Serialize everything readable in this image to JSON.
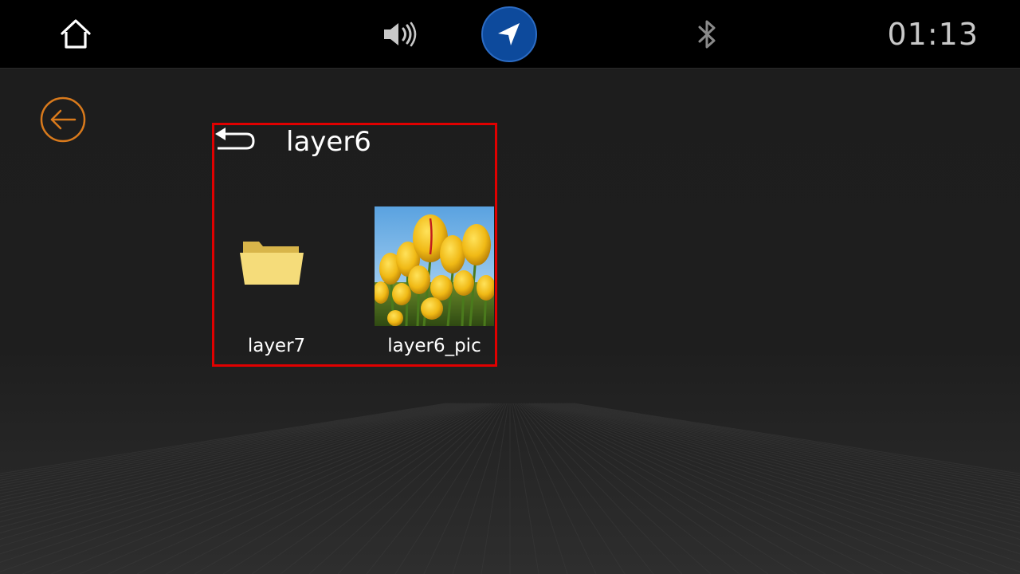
{
  "status_bar": {
    "home_icon": "home-icon",
    "volume_icon": "volume-icon",
    "navigation_icon": "navigation-arrow-icon",
    "bluetooth_icon": "bluetooth-icon",
    "time": "01:13"
  },
  "back_button": {
    "icon": "back-arrow-icon",
    "color": "#d97a1c"
  },
  "file_browser": {
    "up_icon": "return-arrow-icon",
    "current_folder": "layer6",
    "highlight_color": "#e00000",
    "items": [
      {
        "type": "folder",
        "name": "layer7",
        "icon": "folder-icon"
      },
      {
        "type": "image",
        "name": "layer6_pic",
        "thumbnail": "tulips-thumbnail"
      }
    ]
  },
  "colors": {
    "nav_button": "#0d4a9c",
    "folder": "#f2d66b"
  }
}
